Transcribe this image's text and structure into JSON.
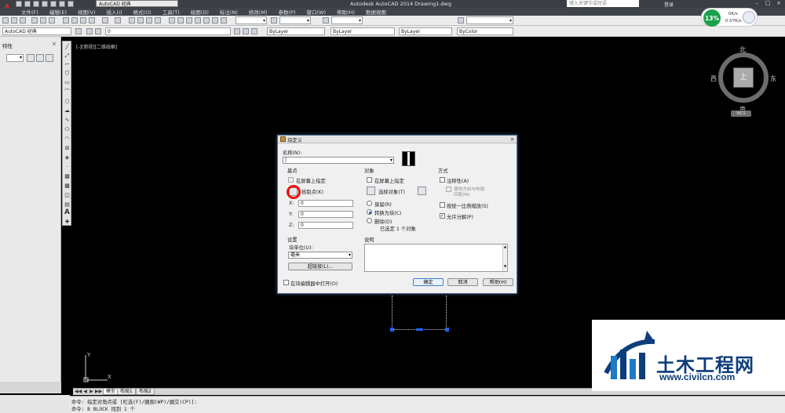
{
  "window": {
    "title": "Autodesk AutoCAD 2014    Drawing1.dwg",
    "workspace": "AutoCAD 经典",
    "search_placeholder": "键入关键字或短语",
    "login": "登录"
  },
  "menu": [
    "文件(F)",
    "编辑(E)",
    "视图(V)",
    "插入(I)",
    "格式(O)",
    "工具(T)",
    "绘图(D)",
    "标注(N)",
    "修改(M)",
    "参数(P)",
    "窗口(W)",
    "帮助(H)",
    "数据视图"
  ],
  "toolbar": {
    "workspace_combo": "AutoCAD 经典",
    "layer_combo": "0",
    "color_combo": "ByLayer",
    "linetype_combo": "ByLayer",
    "lineweight_combo": "ByLayer",
    "plotstyle_combo": "ByColor"
  },
  "network": {
    "percent": "13%",
    "up": "0K/s",
    "down": "0.07K/s"
  },
  "properties": {
    "title": "特性",
    "close": "×"
  },
  "viewport_label": "[-][俯视][二维线框]",
  "viewcube": {
    "north": "北",
    "south": "南",
    "east": "东",
    "west": "西",
    "face": "上",
    "wcs": "WCS"
  },
  "tabs": [
    "模型",
    "布局1",
    "布局2"
  ],
  "command": {
    "line1": "命令: 指定对角点或 [栏选(F)/圈围(WP)/圈交(CP)]:",
    "line2": "命令: B BLOCK 找到 1 个"
  },
  "dialog": {
    "title": "块定义",
    "close": "×",
    "name_label": "名称(N):",
    "name_value": "|",
    "basepoint": {
      "heading": "基点",
      "on_screen": "在屏幕上指定",
      "pick_point": "拾取点(K)",
      "x_label": "X:",
      "x": "0",
      "y_label": "Y:",
      "y": "0",
      "z_label": "Z:",
      "z": "0"
    },
    "objects": {
      "heading": "对象",
      "on_screen": "在屏幕上指定",
      "select": "选择对象(T)",
      "retain": "保留(R)",
      "convert": "转换为块(C)",
      "delete": "删除(D)",
      "status": "已选定 1 个对象"
    },
    "behavior": {
      "heading": "方式",
      "annotative": "注释性(A)",
      "match_orient_1": "使块方向与布局",
      "match_orient_2": "匹配(M)",
      "uniform_scale": "按统一比例缩放(S)",
      "allow_explode": "允许分解(P)"
    },
    "settings": {
      "heading": "设置",
      "unit_label": "块单位(U):",
      "unit_value": "毫米",
      "hyperlink": "超链接(L)..."
    },
    "description": {
      "heading": "说明"
    },
    "open_in_editor": "在块编辑器中打开(O)",
    "ok": "确定",
    "cancel": "取消",
    "help": "帮助(H)"
  },
  "watermark": {
    "title": "土木工程网",
    "url": "www.civilcn.com"
  }
}
